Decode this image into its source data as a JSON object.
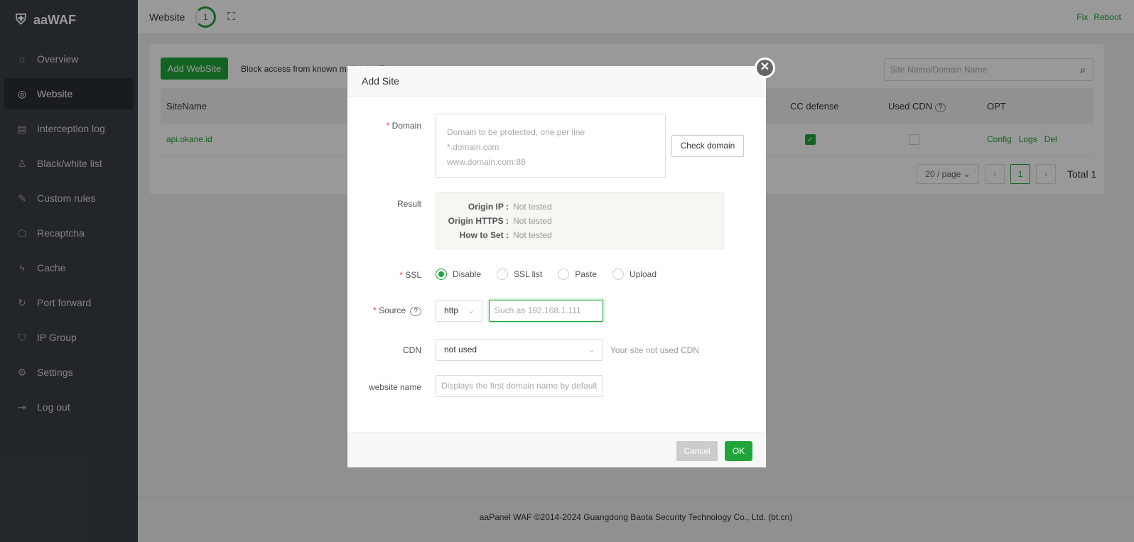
{
  "app": {
    "name": "aaWAF"
  },
  "sidebar": {
    "items": [
      {
        "label": "Overview",
        "icon": "home-icon"
      },
      {
        "label": "Website",
        "icon": "globe-icon",
        "active": true
      },
      {
        "label": "Interception log",
        "icon": "log-icon"
      },
      {
        "label": "Black/white list",
        "icon": "user-icon"
      },
      {
        "label": "Custom rules",
        "icon": "edit-icon"
      },
      {
        "label": "Recaptcha",
        "icon": "robot-icon"
      },
      {
        "label": "Cache",
        "icon": "bolt-icon"
      },
      {
        "label": "Port forward",
        "icon": "refresh-icon"
      },
      {
        "label": "IP Group",
        "icon": "shield-icon"
      },
      {
        "label": "Settings",
        "icon": "gear-icon"
      },
      {
        "label": "Log out",
        "icon": "logout-icon"
      }
    ]
  },
  "header": {
    "title": "Website",
    "count": "1",
    "fix": "Fix",
    "reboot": "Reboot"
  },
  "toolbar": {
    "add_label": "Add WebSite",
    "block_label": "Block access from known malicious IP",
    "search_placeholder": "Site Name/Domain Name"
  },
  "table": {
    "columns": [
      "SiteName",
      "CC defense",
      "Used CDN",
      "OPT"
    ],
    "rows": [
      {
        "site": "api.okane.id",
        "cc_defense": true,
        "used_cdn": false,
        "actions": [
          "Config",
          "Logs",
          "Del"
        ]
      }
    ]
  },
  "pagination": {
    "page_size": "20 / page",
    "current": "1",
    "total": "Total 1"
  },
  "footer": {
    "text": "aaPanel WAF ©2014-2024 Guangdong Baota Security Technology Co., Ltd. (bt.cn)"
  },
  "modal": {
    "title": "Add Site",
    "domain_label": "Domain",
    "domain_placeholder": [
      "Domain to be protected, one per line",
      "*.domain.com",
      "www.domain.com:88"
    ],
    "check_domain": "Check domain",
    "result_label": "Result",
    "result": [
      {
        "k": "Origin IP :",
        "v": "Not tested"
      },
      {
        "k": "Origin HTTPS :",
        "v": "Not tested"
      },
      {
        "k": "How to Set :",
        "v": "Not tested"
      }
    ],
    "ssl_label": "SSL",
    "ssl_options": [
      "Disable",
      "SSL list",
      "Paste",
      "Upload"
    ],
    "ssl_selected": "Disable",
    "source_label": "Source",
    "protocol": "http",
    "source_placeholder": "Such as 192.168.1.111",
    "cdn_label": "CDN",
    "cdn_value": "not used",
    "cdn_hint": "Your site not used CDN",
    "name_label": "website name",
    "name_placeholder": "Displays the first domain name by default",
    "cancel": "Cancel",
    "ok": "OK"
  }
}
